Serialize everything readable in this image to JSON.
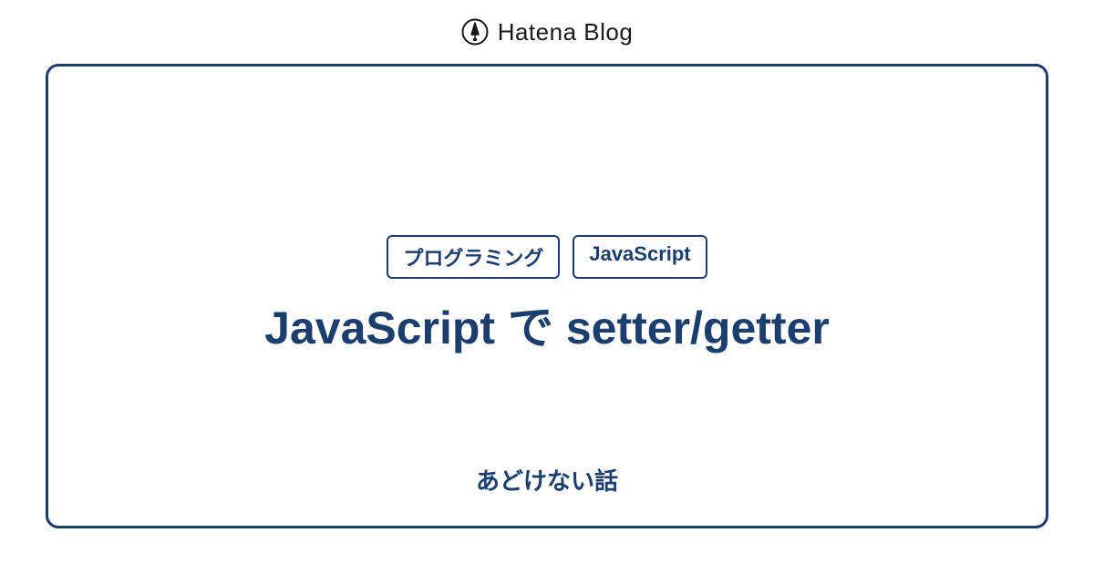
{
  "header": {
    "logo_text": "Hatena Blog"
  },
  "card": {
    "tags": [
      "プログラミング",
      "JavaScript"
    ],
    "title": "JavaScript で setter/getter",
    "subtitle": "あどけない話"
  },
  "colors": {
    "primary": "#1b3e6f"
  }
}
